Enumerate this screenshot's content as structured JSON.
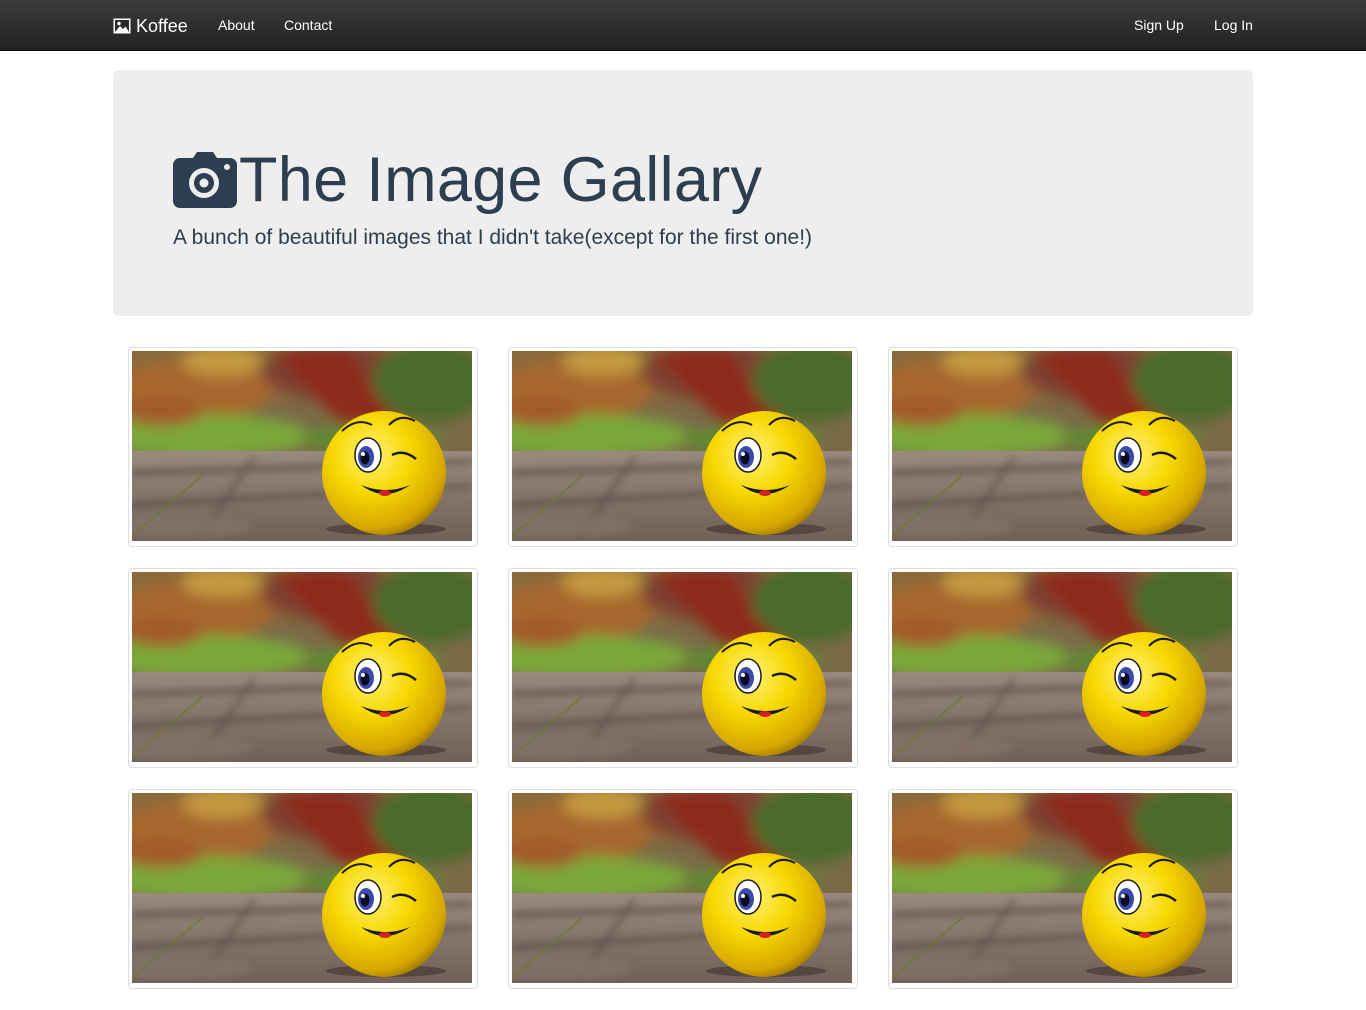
{
  "navbar": {
    "brand": "Koffee",
    "brand_icon": "picture-icon",
    "links": [
      "About",
      "Contact"
    ],
    "right_links": [
      "Sign Up",
      "Log In"
    ]
  },
  "hero": {
    "icon": "camera-icon",
    "title": "The Image Gallary",
    "subtitle": "A bunch of beautiful images that I didn't take(except for the first one!)"
  },
  "gallery": {
    "image_count": 9,
    "image_subject": "winking smiley ball on pavement"
  },
  "colors": {
    "navbar": "#222222",
    "jumbotron": "#eeeeee",
    "text": "#2c3e50"
  }
}
